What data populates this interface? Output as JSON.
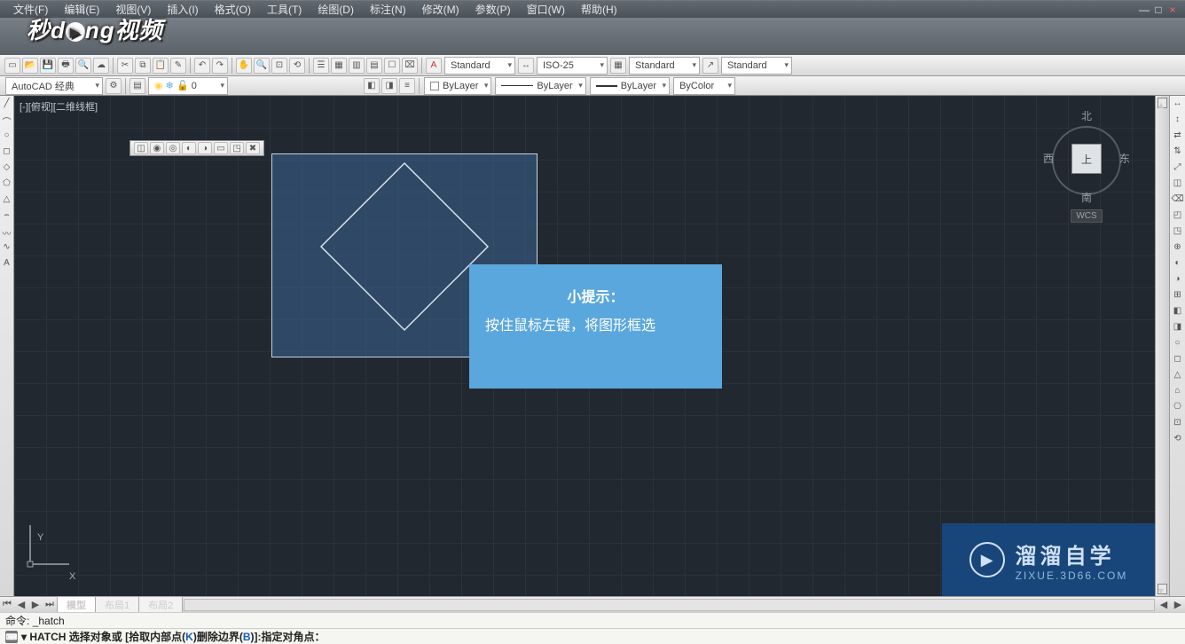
{
  "menu": {
    "items": [
      "文件(F)",
      "编辑(E)",
      "视图(V)",
      "插入(I)",
      "格式(O)",
      "工具(T)",
      "绘图(D)",
      "标注(N)",
      "修改(M)",
      "参数(P)",
      "窗口(W)",
      "帮助(H)"
    ]
  },
  "window_controls": {
    "min": "—",
    "max": "□",
    "close": "×"
  },
  "logo": {
    "text": "秒dong视频"
  },
  "style_strip": {
    "workspace": "AutoCAD 经典",
    "text_style": "Standard",
    "dim_style": "ISO-25",
    "table_style": "Standard",
    "mleader_style": "Standard"
  },
  "layer_strip": {
    "layer_prefix": "0",
    "linetype": "ByLayer",
    "lineweight": "ByLayer",
    "plot": "ByLayer",
    "color": "ByColor"
  },
  "viewport_label": "[-][俯视][二维线框]",
  "viewcube": {
    "n": "北",
    "s": "南",
    "e": "东",
    "w": "西",
    "face": "上",
    "wcs": "WCS"
  },
  "tip": {
    "heading": "小提示：",
    "body": "按住鼠标左键，将图形框选"
  },
  "brand": {
    "title": "溜溜自学",
    "sub": "ZIXUE.3D66.COM"
  },
  "tabs": {
    "items": [
      "模型",
      "布局1",
      "布局2"
    ],
    "active": 0
  },
  "ucs": {
    "y": "Y",
    "x": "X"
  },
  "command": {
    "line1_prefix": "命令:",
    "line1_cmd": "_hatch",
    "line2_prefix": "HATCH 选择对象或 [",
    "opt1_label": "拾取内部点",
    "opt1_key": "K",
    "sep": ") ",
    "opt2_label": "删除边界",
    "opt2_key": "B",
    "line2_suffix": ")]:指定对角点："
  },
  "left_tool_icons": [
    "╱",
    "⌒",
    "○",
    "◻",
    "◇",
    "⬠",
    "△",
    "⌢",
    "〰",
    "∿",
    "A"
  ],
  "right_tool_icons": [
    "↔",
    "↕",
    "⇄",
    "⇅",
    "⤢",
    "◫",
    "⌫",
    "◰",
    "◳",
    "⊕",
    "◐",
    "◑",
    "⊞",
    "◧",
    "◨",
    "○",
    "◻",
    "△",
    "⌂",
    "⎔",
    "⊡",
    "⟲"
  ],
  "float_tool_icons": [
    "◫",
    "◉",
    "◎",
    "◐",
    "◑",
    "▭",
    "◳",
    "✖"
  ]
}
